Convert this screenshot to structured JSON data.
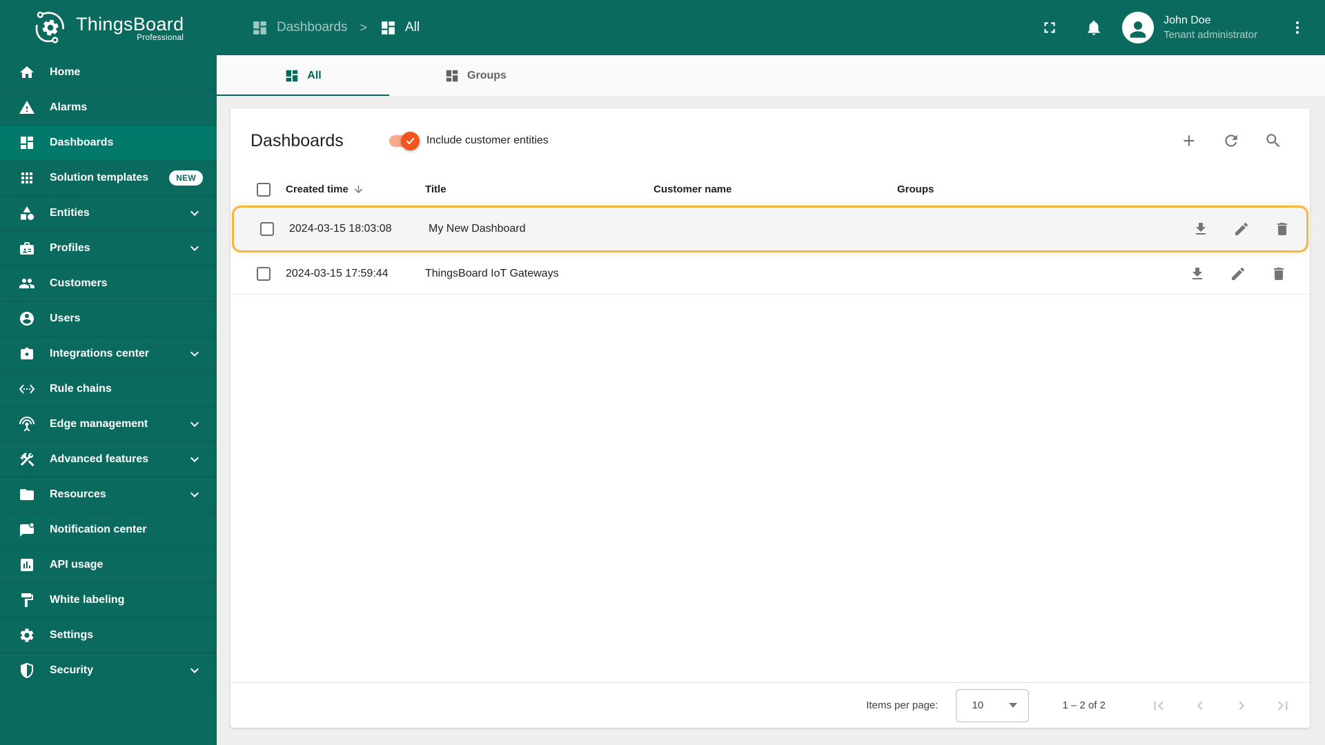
{
  "app": {
    "name": "ThingsBoard",
    "edition": "Professional"
  },
  "topbar": {
    "separator": ">",
    "breadcrumb": [
      {
        "label": "Dashboards",
        "icon": "dashboard-icon"
      },
      {
        "label": "All",
        "icon": "dashboard-icon"
      }
    ],
    "actions": [
      "fullscreen",
      "notifications",
      "account-menu"
    ],
    "user": {
      "name": "John Doe",
      "role": "Tenant administrator"
    }
  },
  "sidebar": {
    "items": [
      {
        "label": "Home",
        "icon": "home-icon",
        "active": false
      },
      {
        "label": "Alarms",
        "icon": "warning-icon",
        "active": false
      },
      {
        "label": "Dashboards",
        "icon": "dashboard-icon",
        "active": true
      },
      {
        "label": "Solution templates",
        "icon": "apps-grid-icon",
        "badge": "NEW",
        "active": false
      },
      {
        "label": "Entities",
        "icon": "category-icon",
        "expandable": true,
        "active": false
      },
      {
        "label": "Profiles",
        "icon": "badge-card-icon",
        "expandable": true,
        "active": false
      },
      {
        "label": "Customers",
        "icon": "people-icon",
        "active": false
      },
      {
        "label": "Users",
        "icon": "account-circle-icon",
        "active": false
      },
      {
        "label": "Integrations center",
        "icon": "integration-icon",
        "expandable": true,
        "active": false
      },
      {
        "label": "Rule chains",
        "icon": "rule-chain-icon",
        "active": false
      },
      {
        "label": "Edge management",
        "icon": "antenna-icon",
        "expandable": true,
        "active": false
      },
      {
        "label": "Advanced features",
        "icon": "construction-icon",
        "expandable": true,
        "active": false
      },
      {
        "label": "Resources",
        "icon": "folder-icon",
        "expandable": true,
        "active": false
      },
      {
        "label": "Notification center",
        "icon": "chat-unread-icon",
        "active": false
      },
      {
        "label": "API usage",
        "icon": "bar-chart-box-icon",
        "active": false
      },
      {
        "label": "White labeling",
        "icon": "paint-icon",
        "active": false
      },
      {
        "label": "Settings",
        "icon": "gear-icon",
        "active": false
      },
      {
        "label": "Security",
        "icon": "shield-icon",
        "expandable": true,
        "active": false
      }
    ]
  },
  "tabs": [
    {
      "label": "All",
      "icon": "dashboard-icon",
      "active": true
    },
    {
      "label": "Groups",
      "icon": "dashboard-icon",
      "active": false
    }
  ],
  "content": {
    "title": "Dashboards",
    "toggle": {
      "label": "Include customer entities",
      "on": true
    },
    "toolbar": [
      "add",
      "refresh",
      "search"
    ],
    "table": {
      "headers": {
        "created": "Created time",
        "title": "Title",
        "customer": "Customer name",
        "groups": "Groups"
      },
      "sort": {
        "column": "Created time",
        "direction": "desc"
      },
      "rows": [
        {
          "created": "2024-03-15 18:03:08",
          "title": "My New Dashboard",
          "customer": "",
          "groups": "",
          "highlighted": true
        },
        {
          "created": "2024-03-15 17:59:44",
          "title": "ThingsBoard IoT Gateways",
          "customer": "",
          "groups": "",
          "highlighted": false
        }
      ],
      "row_actions": [
        "download",
        "edit",
        "delete"
      ]
    },
    "pagination": {
      "items_per_page_label": "Items per page:",
      "items_per_page": "10",
      "range": "1 – 2 of 2"
    }
  },
  "colors": {
    "primary_teal": "#0B6A5E",
    "active_item_teal": "#01796A",
    "tab_active_teal": "#00695C",
    "accent_orange": "#F4541D",
    "toggle_track": "#F9A98C",
    "highlight_border": "#F4B63D"
  }
}
